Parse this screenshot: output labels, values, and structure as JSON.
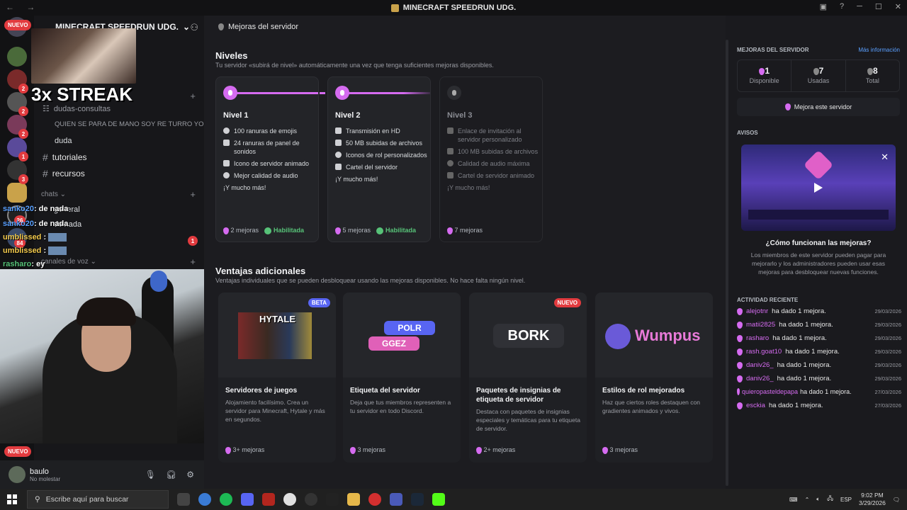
{
  "window": {
    "title": "MINECRAFT SPEEDRUN UDG.",
    "back": "←",
    "forward": "→"
  },
  "rail": {
    "badges": [
      "2",
      "2",
      "2",
      "1",
      "3",
      "26",
      "84"
    ],
    "nuevo_top": "NUEVO",
    "nuevo_bottom": "NUEVO"
  },
  "server": {
    "name": "MINECRAFT SPEEDRUN UDG.",
    "channels": [
      {
        "name": "dudas-consultas"
      },
      {
        "name": "QUIEN SE PARA DE MANO SOY RE TURRO YO"
      },
      {
        "name": "duda"
      },
      {
        "name": "tutoriales"
      },
      {
        "name": "recursos"
      }
    ],
    "chats_category": "chats",
    "voice_category": "canales de voz",
    "chat_channels": [
      "general",
      "delnada"
    ],
    "mentions_badge": "1"
  },
  "stream_overlay": {
    "streak": "3x STREAK",
    "chat": [
      {
        "user": "sanko20",
        "msg": ": de nada"
      },
      {
        "user": "sanko20",
        "msg": ": de nada"
      },
      {
        "user": "umblissed",
        "msg": ":"
      },
      {
        "user": "umblissed",
        "msg": ":"
      },
      {
        "user": "rasharo",
        "msg": ": ey"
      }
    ]
  },
  "user": {
    "name": "baulo",
    "status": "No molestar"
  },
  "main": {
    "header": "Mejoras del servidor",
    "levels_title": "Niveles",
    "levels_sub": "Tu servidor «subirá de nivel» automáticamente una vez que tenga suficientes mejoras disponibles.",
    "levels": [
      {
        "name": "Nivel 1",
        "perks": [
          "100 ranuras de emojis",
          "24 ranuras de panel de sonidos",
          "Icono de servidor animado",
          "Mejor calidad de audio"
        ],
        "more": "¡Y mucho más!",
        "boosts": "2 mejoras",
        "status": "Habilitada"
      },
      {
        "name": "Nivel 2",
        "perks": [
          "Transmisión en HD",
          "50 MB subidas de archivos",
          "Iconos de rol personalizados",
          "Cartel del servidor"
        ],
        "more": "¡Y mucho más!",
        "boosts": "5 mejoras",
        "status": "Habilitada"
      },
      {
        "name": "Nivel 3",
        "perks": [
          "Enlace de invitación al servidor personalizado",
          "100 MB subidas de archivos",
          "Calidad de audio máxima",
          "Cartel de servidor animado"
        ],
        "more": "¡Y mucho más!",
        "boosts": "7 mejoras",
        "status": ""
      }
    ],
    "extras_title": "Ventajas adicionales",
    "extras_sub": "Ventajas individuales que se pueden desbloquear usando las mejoras disponibles. No hace falta ningún nivel.",
    "extras": [
      {
        "name": "Servidores de juegos",
        "desc": "Alojamiento facilísimo. Crea un servidor para Minecraft, Hytale y más en segundos.",
        "boosts": "3+ mejoras",
        "tag": "BETA",
        "tag_color": "#5865f2",
        "art": "HYTALE"
      },
      {
        "name": "Etiqueta del servidor",
        "desc": "Deja que tus miembros representen a tu servidor en todo Discord.",
        "boosts": "3 mejoras",
        "tag": "",
        "tag_color": "",
        "art1": "POLR",
        "art2": "GGEZ"
      },
      {
        "name": "Paquetes de insignias de etiqueta de servidor",
        "desc": "Destaca con paquetes de insignias especiales y temáticas para tu etiqueta de servidor.",
        "boosts": "2+ mejoras",
        "tag": "NUEVO",
        "tag_color": "#e23b3f",
        "art": "BORK"
      },
      {
        "name": "Estilos de rol mejorados",
        "desc": "Haz que ciertos roles destaquen con gradientes animados y vivos.",
        "boosts": "3 mejoras",
        "tag": "",
        "tag_color": "",
        "art": "Wumpus"
      }
    ]
  },
  "sidebar_right": {
    "boosts_header": "MEJORAS DEL SERVIDOR",
    "more_info": "Más información",
    "stats": [
      {
        "value": "1",
        "label": "Disponible"
      },
      {
        "value": "7",
        "label": "Usadas"
      },
      {
        "value": "8",
        "label": "Total"
      }
    ],
    "boost_button": "Mejora este servidor",
    "notices_header": "AVISOS",
    "howto_title": "¿Cómo funcionan las mejoras?",
    "howto_desc": "Los miembros de este servidor pueden pagar para mejorarlo y los administradores pueden usar esas mejoras para desbloquear nuevas funciones.",
    "activity_header": "ACTIVIDAD RECIENTE",
    "activity": [
      {
        "who": "alejotnr",
        "text": "ha dado 1 mejora.",
        "date": "29/03/2026"
      },
      {
        "who": "matii2825",
        "text": "ha dado 1 mejora.",
        "date": "29/03/2026"
      },
      {
        "who": "rasharo",
        "text": "ha dado 1 mejora.",
        "date": "29/03/2026"
      },
      {
        "who": "rash.goat10",
        "text": "ha dado 1 mejora.",
        "date": "29/03/2026"
      },
      {
        "who": "daniv26_",
        "text": "ha dado 1 mejora.",
        "date": "29/03/2026"
      },
      {
        "who": "daniv26_",
        "text": "ha dado 1 mejora.",
        "date": "29/03/2026"
      },
      {
        "who": "quieropasteldepapa",
        "text": "ha dado 1 mejora.",
        "date": "27/03/2026"
      },
      {
        "who": "esckia",
        "text": "ha dado 1 mejora.",
        "date": "27/03/2026"
      }
    ]
  },
  "taskbar": {
    "search_placeholder": "Escribe aquí para buscar",
    "lang": "ESP",
    "time": "9:02 PM",
    "date": "3/29/2026"
  },
  "colors": {
    "boost": "#d56bf0",
    "enabled": "#57c278",
    "link": "#5aa0ff"
  }
}
